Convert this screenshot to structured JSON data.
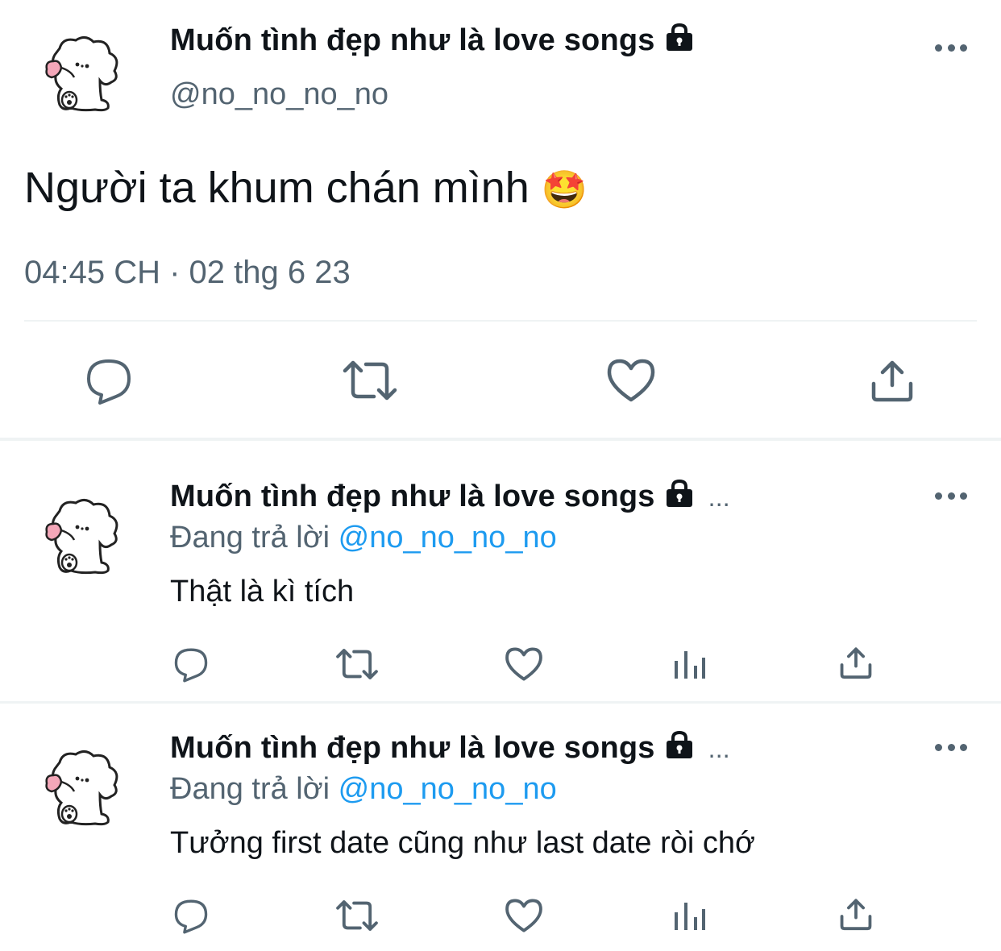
{
  "main_tweet": {
    "author_name": "Muốn tình đẹp như là love songs",
    "author_handle": "@no_no_no_no",
    "text": "Người ta khum chán mình",
    "emoji": "🤩",
    "timestamp": "04:45 CH · 02 thg 6 23"
  },
  "replies": [
    {
      "author_name": "Muốn tình đẹp như là love songs",
      "ellipsis": "...",
      "replying_prefix": "Đang trả lời",
      "replying_handle": "@no_no_no_no",
      "text": "Thật là kì tích"
    },
    {
      "author_name": "Muốn tình đẹp như là love songs",
      "ellipsis": "...",
      "replying_prefix": "Đang trả lời",
      "replying_handle": "@no_no_no_no",
      "text": "Tưởng first date cũng như last date ròi chớ"
    }
  ],
  "colors": {
    "text": "#0f1419",
    "secondary": "#536471",
    "link": "#1d9bf0",
    "divider": "#eff3f4"
  },
  "icons": [
    "more-icon",
    "lock-icon",
    "reply-icon",
    "retweet-icon",
    "like-icon",
    "views-icon",
    "share-icon"
  ]
}
